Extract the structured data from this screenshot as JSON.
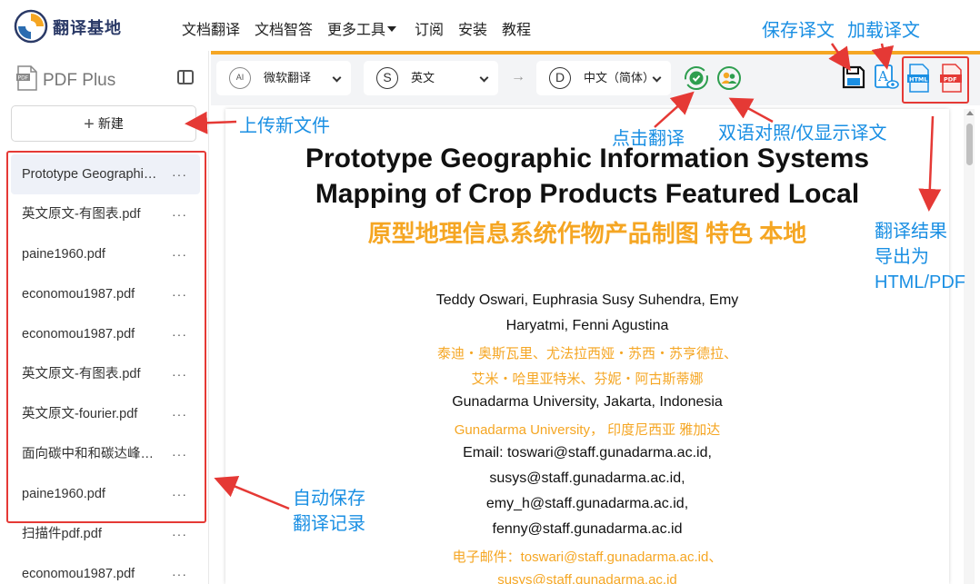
{
  "nav": {
    "brand": "翻译基地",
    "items": [
      "文档翻译",
      "文档智答",
      "更多工具",
      "订阅",
      "安装",
      "教程"
    ]
  },
  "sidebar": {
    "title": "PDF Plus",
    "new_button": "新建",
    "more": "···",
    "files": [
      "Prototype Geographic Information Systems",
      "英文原文-有图表.pdf",
      "paine1960.pdf",
      "economou1987.pdf",
      "economou1987.pdf",
      "英文原文-有图表.pdf",
      "英文原文-fourier.pdf",
      "面向碳中和和碳达峰目标",
      "paine1960.pdf",
      "扫描件pdf.pdf",
      "economou1987.pdf"
    ]
  },
  "toolbar": {
    "engine": "微软翻译",
    "engine_icon": "AI",
    "source_lang": "英文",
    "source_icon": "S",
    "target_lang": "中文（简体）",
    "target_icon": "D",
    "arrow": "→",
    "html_label": "HTML",
    "pdf_label": "PDF"
  },
  "document": {
    "title_en_1": "Prototype Geographic Information Systems",
    "title_en_2": "Mapping of Crop Products Featured Local",
    "title_zh": "原型地理信息系统作物产品制图 特色 本地",
    "lines": [
      {
        "text": "Teddy Oswari, Euphrasia Susy Suhendra, Emy",
        "zh": false
      },
      {
        "text": "Haryatmi, Fenni Agustina",
        "zh": false
      },
      {
        "text": "泰迪・奥斯瓦里、尤法拉西娅・苏西・苏亨德拉、",
        "zh": true
      },
      {
        "text": "艾米・哈里亚特米、芬妮・阿古斯蒂娜",
        "zh": true
      },
      {
        "text": "Gunadarma University, Jakarta, Indonesia",
        "zh": false
      },
      {
        "text": "Gunadarma University， 印度尼西亚 雅加达",
        "zh": true
      },
      {
        "text": "Email: toswari@staff.gunadarma.ac.id,",
        "zh": false
      },
      {
        "text": "susys@staff.gunadarma.ac.id,",
        "zh": false
      },
      {
        "text": "emy_h@staff.gunadarma.ac.id,",
        "zh": false
      },
      {
        "text": "fenny@staff.gunadarma.ac.id",
        "zh": false
      },
      {
        "text": "电子邮件：toswari@staff.gunadarma.ac.id、",
        "zh": true
      },
      {
        "text": "susys@staff.gunadarma.ac.id",
        "zh": true
      }
    ]
  },
  "annotations": {
    "upload": "上传新文件",
    "click_translate": "点击翻译",
    "bilingual": "双语对照/仅显示译文",
    "save": "保存译文",
    "load": "加载译文",
    "export_1": "翻译结果",
    "export_2": "导出为",
    "export_3": "HTML/PDF",
    "autosave_1": "自动保存",
    "autosave_2": "翻译记录"
  },
  "colors": {
    "accent": "#f5a623",
    "annotation": "#1a8fe3",
    "highlight": "#e53935"
  }
}
